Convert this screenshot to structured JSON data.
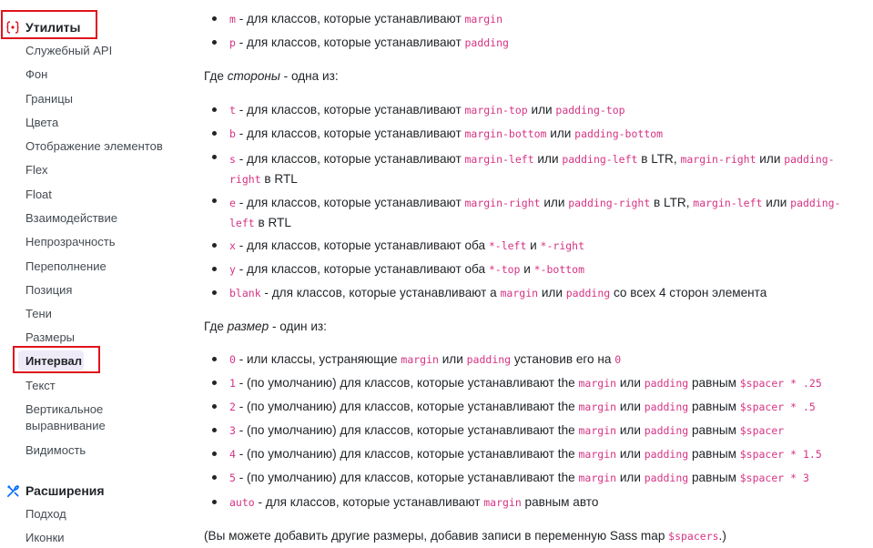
{
  "sidebar": {
    "utilities_title": "Утилиты",
    "utilities_items": [
      "Служебный API",
      "Фон",
      "Границы",
      "Цвета",
      "Отображение элементов",
      "Flex",
      "Float",
      "Взаимодействие",
      "Непрозрачность",
      "Переполнение",
      "Позиция",
      "Тени",
      "Размеры",
      "Интервал",
      "Текст",
      "Вертикальное\nвыравнивание",
      "Видимость"
    ],
    "active_item": "Интервал",
    "extensions_title": "Расширения",
    "extensions_items": [
      "Подход",
      "Иконки"
    ],
    "accent_color": "#7952b3",
    "highlight_color": "#e0141b"
  },
  "content": {
    "m_code": "m",
    "m_text": " - для классов, которые устанавливают ",
    "margin": "margin",
    "p_code": "p",
    "p_text": " - для классов, которые устанавливают ",
    "padding": "padding",
    "sides_pre": "Где ",
    "sides_em": "стороны",
    "sides_post": " - одна из:",
    "t_code": "t",
    "t_text": " - для классов, которые устанавливают ",
    "margin_top": "margin-top",
    "or": " или ",
    "padding_top": "padding-top",
    "b_code": "b",
    "b_text": " - для классов, которые устанавливают ",
    "margin_bottom": "margin-bottom",
    "padding_bottom": "padding-bottom",
    "s_code": "s",
    "s_text": " - для классов, которые устанавливают ",
    "margin_left": "margin-left",
    "padding_left": "padding-left",
    "in_ltr": " в LTR, ",
    "margin_right": "margin-right",
    "padding_right_1": "padding-",
    "padding_right_2": "right",
    "in_rtl": " в RTL",
    "e_code": "e",
    "e_text": " - для классов, которые устанавливают ",
    "padding_left_1": "padding-",
    "padding_left_2": "left",
    "x_code": "x",
    "x_text": " - для классов, которые устанавливают оба ",
    "star_left": "*-left",
    "and": " и ",
    "star_right": "*-right",
    "y_code": "y",
    "y_text": " - для классов, которые устанавливают оба ",
    "star_top": "*-top",
    "star_bottom": "*-bottom",
    "blank_code": "blank",
    "blank_text": " - для классов, которые устанавливают а ",
    "blank_tail": " со всех 4 сторон элемента",
    "size_pre": "Где ",
    "size_em": "размер",
    "size_post": " - один из:",
    "zero_code": "0",
    "zero_text": " - или классы, устраняющие ",
    "zero_mid": " установив его на ",
    "zero_end": "0",
    "default_text": " - (по умолчанию) для классов, которые устанавливают the ",
    "equal": " равным ",
    "s1_code": "1",
    "s1_val": "$spacer * .25",
    "s2_code": "2",
    "s2_val": "$spacer * .5",
    "s3_code": "3",
    "s3_val": "$spacer",
    "s4_code": "4",
    "s4_val": "$spacer * 1.5",
    "s5_code": "5",
    "s5_val": "$spacer * 3",
    "auto_code": "auto",
    "auto_text": " - для классов, которые устанавливают ",
    "auto_tail": " равным авто",
    "footer_pre": "(Вы можете добавить другие размеры, добавив записи в переменную Sass map ",
    "footer_code": "$spacers",
    "footer_post": ".)"
  }
}
